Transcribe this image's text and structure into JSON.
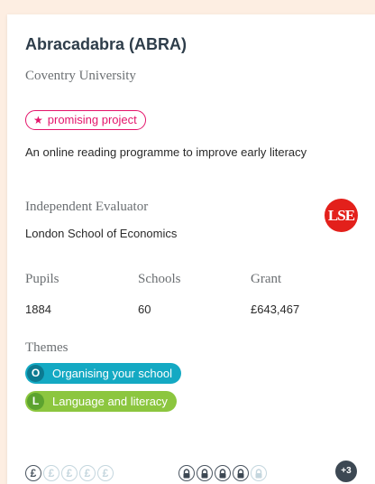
{
  "project": {
    "title": "Abracadabra (ABRA)",
    "organisation": "Coventry University",
    "badge": "promising project",
    "description": "An online reading programme to improve early literacy"
  },
  "evaluator": {
    "label": "Independent Evaluator",
    "name": "London School of Economics",
    "logo_text": "LSE",
    "logo_color": "#e3201b"
  },
  "stats": [
    {
      "label": "Pupils",
      "value": "1884"
    },
    {
      "label": "Schools",
      "value": "60"
    },
    {
      "label": "Grant",
      "value": "£643,467"
    }
  ],
  "themes": {
    "label": "Themes",
    "items": [
      {
        "letter": "O",
        "name": "Organising your school",
        "color": "#14a9c3"
      },
      {
        "letter": "L",
        "name": "Language and literacy",
        "color": "#8cc63f"
      }
    ]
  },
  "ratings": {
    "cost": {
      "symbol": "£",
      "filled": 1,
      "total": 5,
      "icon": "pound-icon"
    },
    "security": {
      "filled": 4,
      "total": 5,
      "icon": "padlock-icon"
    },
    "more_label": "+3"
  },
  "colors": {
    "background": "#fdeee2",
    "badge": "#e4156b",
    "title": "#2e3d4a"
  }
}
